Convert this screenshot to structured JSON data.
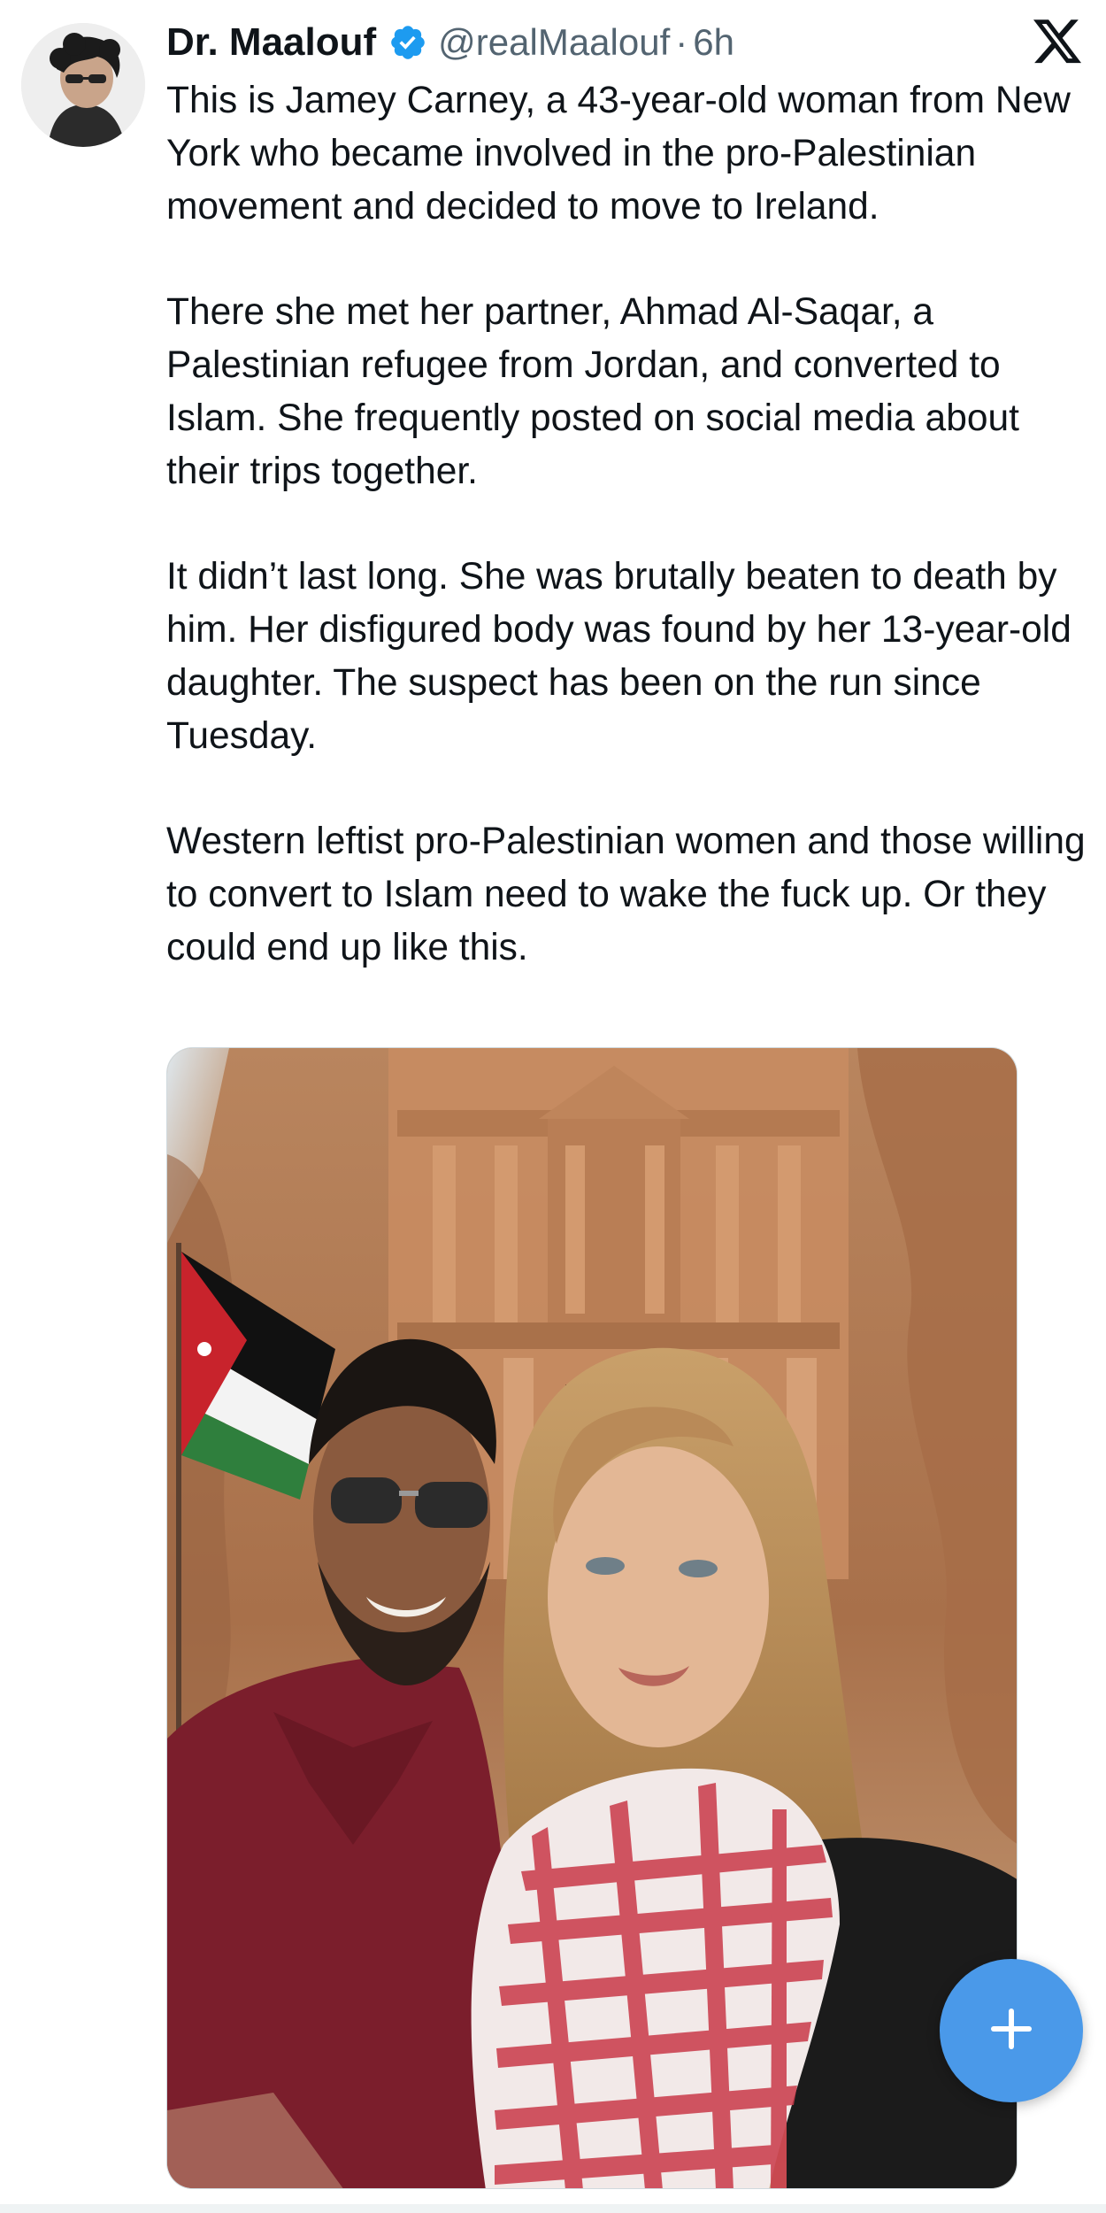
{
  "tweet": {
    "display_name": "Dr. Maalouf",
    "handle": "@realMaalouf",
    "separator": "·",
    "time": "6h",
    "paragraphs": [
      "This is Jamey Carney, a 43-year-old woman from New York who became involved in the pro-Palestinian movement and decided to move to Ireland.",
      "There she met her partner, Ahmad Al-Saqar, a Palestinian refugee from Jordan, and converted to Islam. She frequently posted on social media about their trips together.",
      "It didn’t last long. She was brutally beaten to death by him. Her disfigured body was found by her 13-year-old daughter. The suspect has been on the run since Tuesday.",
      "Western leftist pro-Palestinian women and those willing to convert to Islam need to wake the fuck up. Or they could end up like this."
    ],
    "verified": true
  },
  "icons": {
    "verified": "verified-badge-icon",
    "platform": "x-logo-icon",
    "compose": "plus-icon"
  },
  "colors": {
    "text": "#0f1419",
    "secondary_text": "#536471",
    "verified_blue": "#1d9bf0",
    "fab_blue": "#4a99e9"
  }
}
